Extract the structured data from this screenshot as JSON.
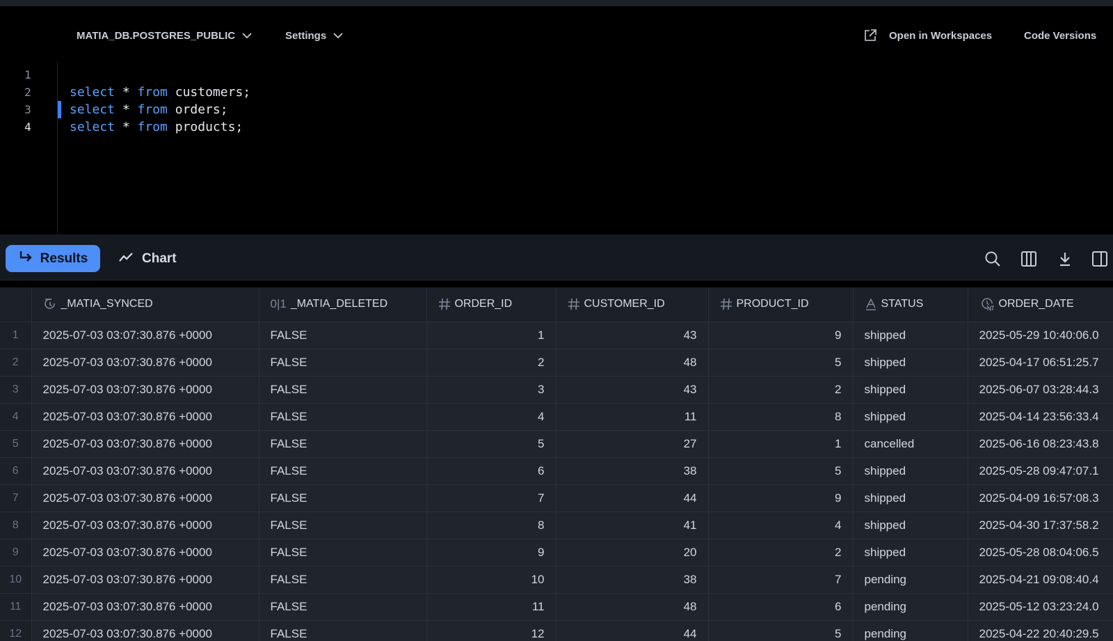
{
  "toolbar": {
    "database": "MATIA_DB.POSTGRES_PUBLIC",
    "settings": "Settings",
    "open_workspaces": "Open in Workspaces",
    "code_versions": "Code Versions"
  },
  "editor": {
    "line_numbers": [
      "1",
      "2",
      "3",
      "4"
    ],
    "lines": [
      {
        "kw1": "select",
        "mid": " * ",
        "kw2": "from",
        "rest": " customers;"
      },
      {
        "kw1": "select",
        "mid": " * ",
        "kw2": "from",
        "rest": " orders;"
      },
      {
        "kw1": "select",
        "mid": " * ",
        "kw2": "from",
        "rest": " products;"
      }
    ]
  },
  "results_bar": {
    "results_tab": "Results",
    "chart_tab": "Chart",
    "icons": [
      "search-icon",
      "columns-icon",
      "download-icon",
      "panel-toggle-icon"
    ]
  },
  "table": {
    "columns": [
      {
        "label": "_MATIA_SYNCED",
        "icon": "sync-time-icon"
      },
      {
        "label": "_MATIA_DELETED",
        "icon": "boolean-icon"
      },
      {
        "label": "ORDER_ID",
        "icon": "hash-icon"
      },
      {
        "label": "CUSTOMER_ID",
        "icon": "hash-icon"
      },
      {
        "label": "PRODUCT_ID",
        "icon": "hash-icon"
      },
      {
        "label": "STATUS",
        "icon": "text-icon"
      },
      {
        "label": "ORDER_DATE",
        "icon": "timestamp-ntz-icon"
      }
    ],
    "boolean_icon_text": "0|1",
    "rows": [
      [
        "1",
        "2025-07-03 03:07:30.876 +0000",
        "FALSE",
        "1",
        "43",
        "9",
        "shipped",
        "2025-05-29 10:40:06.0"
      ],
      [
        "2",
        "2025-07-03 03:07:30.876 +0000",
        "FALSE",
        "2",
        "48",
        "5",
        "shipped",
        "2025-04-17 06:51:25.7"
      ],
      [
        "3",
        "2025-07-03 03:07:30.876 +0000",
        "FALSE",
        "3",
        "43",
        "2",
        "shipped",
        "2025-06-07 03:28:44.3"
      ],
      [
        "4",
        "2025-07-03 03:07:30.876 +0000",
        "FALSE",
        "4",
        "11",
        "8",
        "shipped",
        "2025-04-14 23:56:33.4"
      ],
      [
        "5",
        "2025-07-03 03:07:30.876 +0000",
        "FALSE",
        "5",
        "27",
        "1",
        "cancelled",
        "2025-06-16 08:23:43.8"
      ],
      [
        "6",
        "2025-07-03 03:07:30.876 +0000",
        "FALSE",
        "6",
        "38",
        "5",
        "shipped",
        "2025-05-28 09:47:07.1"
      ],
      [
        "7",
        "2025-07-03 03:07:30.876 +0000",
        "FALSE",
        "7",
        "44",
        "9",
        "shipped",
        "2025-04-09 16:57:08.3"
      ],
      [
        "8",
        "2025-07-03 03:07:30.876 +0000",
        "FALSE",
        "8",
        "41",
        "4",
        "shipped",
        "2025-04-30 17:37:58.2"
      ],
      [
        "9",
        "2025-07-03 03:07:30.876 +0000",
        "FALSE",
        "9",
        "20",
        "2",
        "shipped",
        "2025-05-28 08:04:06.5"
      ],
      [
        "10",
        "2025-07-03 03:07:30.876 +0000",
        "FALSE",
        "10",
        "38",
        "7",
        "pending",
        "2025-04-21 09:08:40.4"
      ],
      [
        "11",
        "2025-07-03 03:07:30.876 +0000",
        "FALSE",
        "11",
        "48",
        "6",
        "pending",
        "2025-05-12 03:23:24.0"
      ],
      [
        "12",
        "2025-07-03 03:07:30.876 +0000",
        "FALSE",
        "12",
        "44",
        "5",
        "pending",
        "2025-04-22 20:40:29.5"
      ]
    ]
  }
}
